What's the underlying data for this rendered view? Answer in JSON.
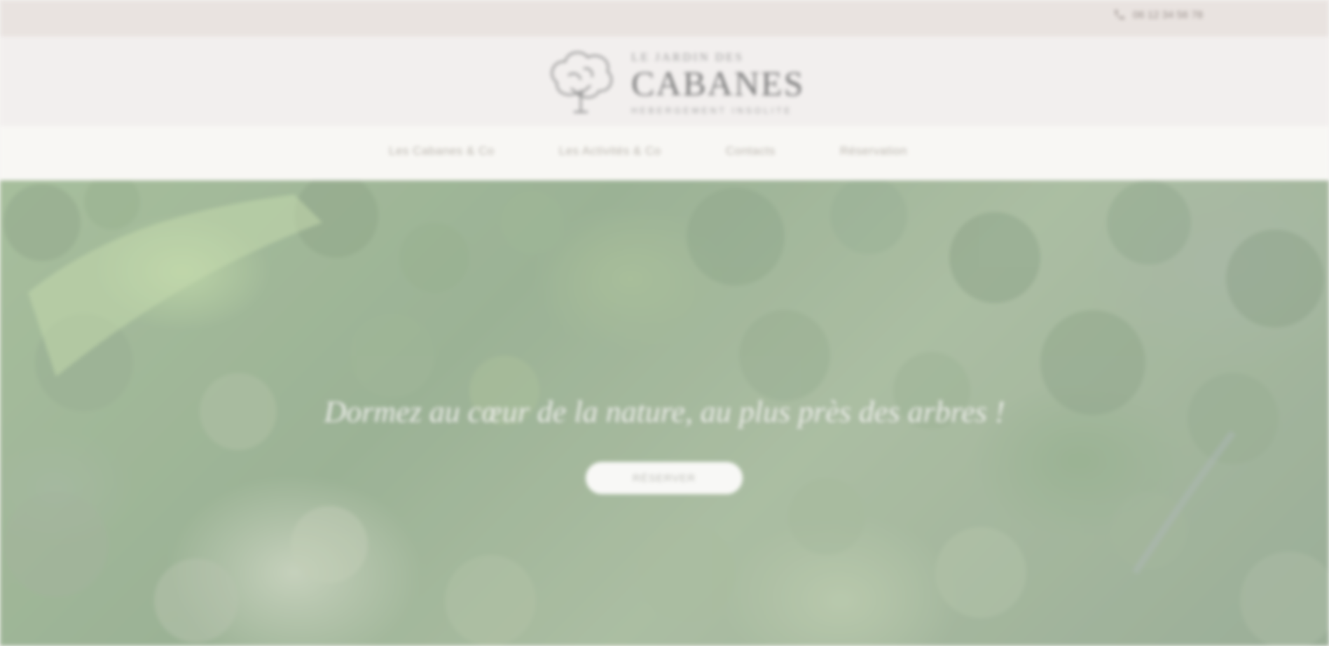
{
  "topbar": {
    "phone_icon": "phone-icon",
    "phone_text": "06 12 34 56 78"
  },
  "header": {
    "logo_line1": "LE JARDIN DES",
    "logo_line2": "CABANES",
    "logo_line3": "HEBERGEMENT INSOLITE",
    "logo_icon": "tree-logo-icon"
  },
  "nav": {
    "items": [
      {
        "label": "Les Cabanes & Co"
      },
      {
        "label": "Les Activités & Co"
      },
      {
        "label": "Contacts"
      },
      {
        "label": "Réservation"
      }
    ]
  },
  "hero": {
    "tagline": "Dormez au cœur de la nature, au plus près des arbres !",
    "button_label": "RÉSERVER"
  },
  "colors": {
    "topbar_bg": "#e9e3e0",
    "header_bg": "#f2efee",
    "nav_bg": "#f8f7f4",
    "forest_green": "#8fae82",
    "button_bg": "#f8f8f6"
  }
}
